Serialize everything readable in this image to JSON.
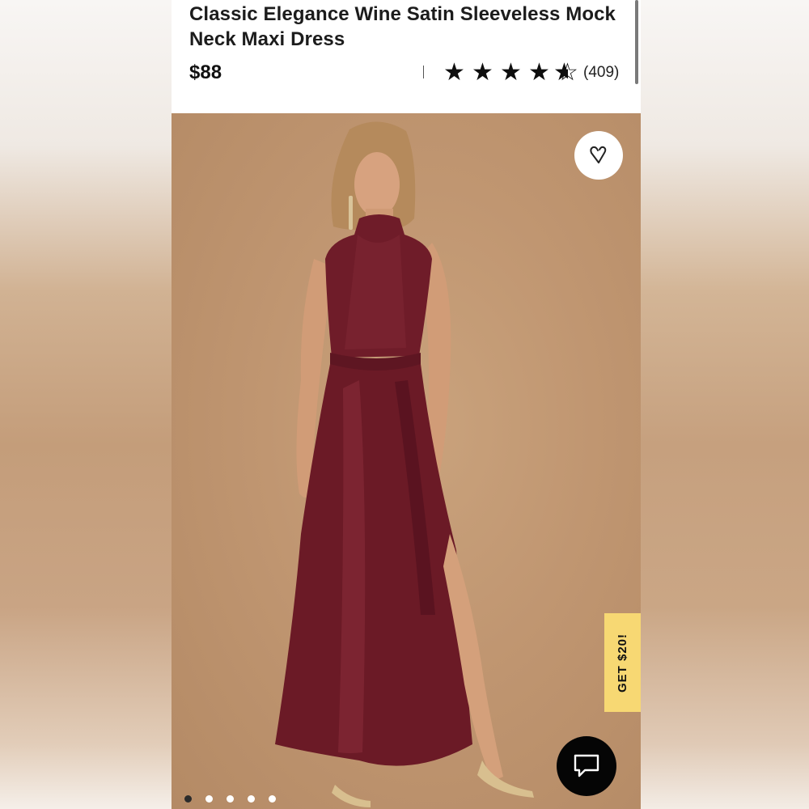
{
  "product": {
    "title": "Classic Elegance Wine Satin Sleeveless Mock Neck Maxi Dress",
    "price": "$88",
    "rating": 4.5,
    "rating_max": 5,
    "review_count": "(409)"
  },
  "icons": {
    "favorite": "heart-icon",
    "chat": "chat-bubble-icon",
    "star": "star-icon"
  },
  "promo": {
    "label": "GET $20!"
  },
  "carousel": {
    "count": 5,
    "active_index": 0
  },
  "colors": {
    "promo_bg": "#f7d873",
    "dress": "#6b1a26",
    "photo_bg": "#c09671"
  }
}
